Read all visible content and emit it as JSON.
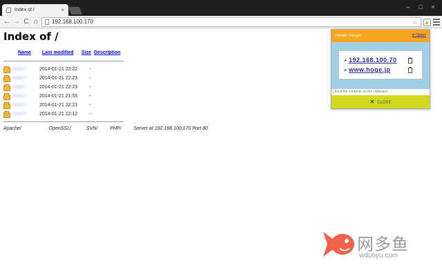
{
  "browser": {
    "tab_title": "Index of /",
    "tab_close": "×",
    "url": "192.168.100.170",
    "back": "←",
    "forward": "→",
    "reload": "C",
    "home": "⌂",
    "star": "☆",
    "win_min": "–",
    "win_max": "□",
    "win_close": "×"
  },
  "page": {
    "title": "Index of /",
    "headers": {
      "name": "Name",
      "last_modified": "Last modified",
      "size": "Size",
      "description": "Description"
    },
    "rows": [
      {
        "name": "folder/",
        "date": "2014-01-21 22:22",
        "size": "-"
      },
      {
        "name": "folder/",
        "date": "2014-01-21 22:23",
        "size": "-"
      },
      {
        "name": "folder/",
        "date": "2014-01-21 22:23",
        "size": "-"
      },
      {
        "name": "folder/",
        "date": "2014-01-21 21:55",
        "size": "-"
      },
      {
        "name": "folder/",
        "date": "2014-01-21 22:21",
        "size": "-"
      },
      {
        "name": "folder/",
        "date": "2014-01-21 22:12",
        "size": "-"
      }
    ],
    "address": {
      "apache": "Apache/",
      "openssl": "OpenSSL/",
      "svn": "SVN/",
      "php": "PHP/",
      "server": "Server at 192.168.100.170 Port 80"
    }
  },
  "popup": {
    "title": "Domain Changer",
    "option": "Option",
    "domains": [
      "192.168.100.70",
      "www.hoge.jp"
    ],
    "note": "Check the contents on the clipboard.",
    "close": "CLOSE",
    "close_glyph": "✕"
  },
  "watermark": {
    "cn": "网多鱼",
    "en": "wduoyu.com"
  },
  "colors": {
    "popup_header": "#f6a51f",
    "popup_body": "#9fd0e6",
    "popup_close": "#cfda1c",
    "link": "#0000ee",
    "folder": "#f4b642",
    "watermark_fish": "#f2614a"
  }
}
